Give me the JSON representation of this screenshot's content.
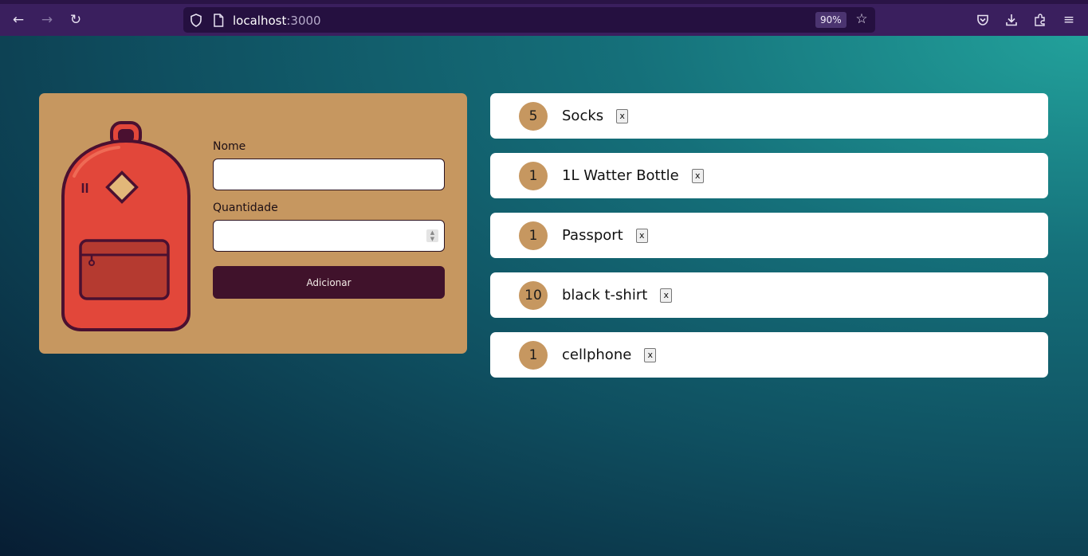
{
  "browser": {
    "url_host": "localhost",
    "url_port": ":3000",
    "zoom": "90%"
  },
  "form": {
    "name_label": "Nome",
    "name_value": "",
    "quantity_label": "Quantidade",
    "quantity_value": "",
    "submit_label": "Adicionar"
  },
  "items": [
    {
      "quantity": "5",
      "name": "Socks",
      "remove_label": "x"
    },
    {
      "quantity": "1",
      "name": "1L Watter Bottle",
      "remove_label": "x"
    },
    {
      "quantity": "1",
      "name": "Passport",
      "remove_label": "x"
    },
    {
      "quantity": "10",
      "name": "black t-shirt",
      "remove_label": "x"
    },
    {
      "quantity": "1",
      "name": "cellphone",
      "remove_label": "x"
    }
  ],
  "colors": {
    "card": "#c69760",
    "button": "#40122b",
    "chrome": "#3a1f5e"
  }
}
